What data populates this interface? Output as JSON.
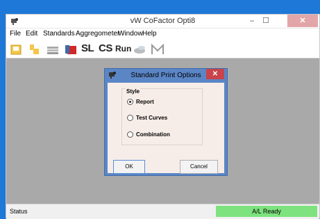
{
  "window": {
    "title": "vW CoFactor Opti8",
    "minimize_glyph": "–",
    "maximize_glyph": "☐",
    "close_glyph": "✕"
  },
  "menu": {
    "items": [
      "File",
      "Edit",
      "Standards",
      "Aggregometer",
      "Window",
      "Help"
    ]
  },
  "toolbar": {
    "icons": [
      "open-folder-icon",
      "new-file-icon",
      "stack-icon",
      "record-book-icon",
      "sl-icon",
      "cs-icon",
      "run-icon",
      "disk-icon",
      "m-icon"
    ],
    "sl_label": "SL",
    "cs_label": "CS",
    "run_label": "Run"
  },
  "status": {
    "text": "Status",
    "ready": "A/L Ready",
    "ready_color": "#7ee27e"
  },
  "dialog": {
    "title": "Standard Print Options",
    "close_glyph": "✕",
    "group_label": "Style",
    "options": [
      {
        "label": "Report",
        "selected": true
      },
      {
        "label": "Test Curves",
        "selected": false
      },
      {
        "label": "Combination",
        "selected": false
      }
    ],
    "ok_label": "OK",
    "cancel_label": "Cancel"
  }
}
